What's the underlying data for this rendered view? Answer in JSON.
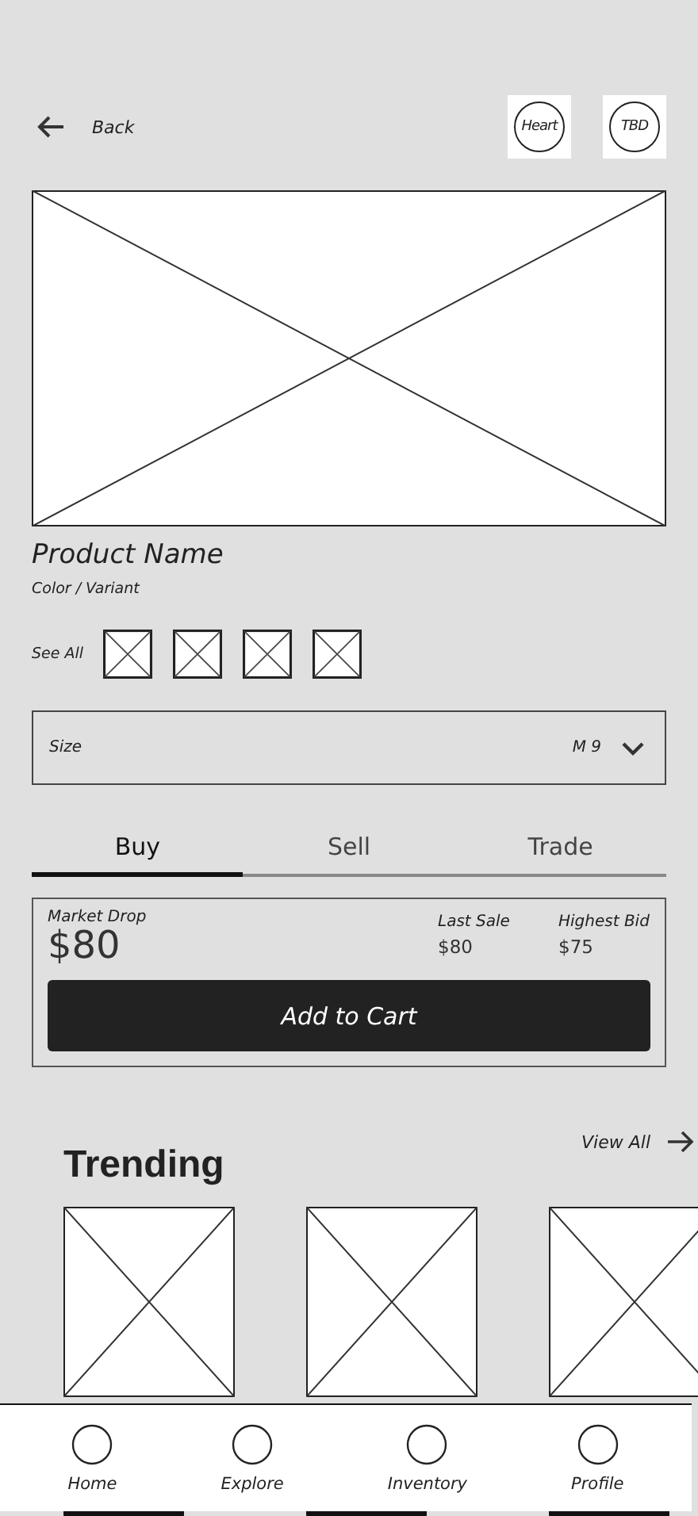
{
  "header": {
    "back_label": "Back",
    "actions": [
      {
        "label": "Heart"
      },
      {
        "label": "TBD"
      }
    ]
  },
  "product": {
    "name": "Product Name",
    "variant": "Color / Variant",
    "see_all": "See All",
    "swatches": [
      {
        "kind": "placeholder"
      },
      {
        "kind": "placeholder"
      },
      {
        "kind": "placeholder"
      },
      {
        "kind": "placeholder"
      }
    ]
  },
  "size": {
    "label": "Size",
    "value": "M 9"
  },
  "tabs": [
    {
      "label": "Buy",
      "selected": true
    },
    {
      "label": "Sell",
      "selected": false
    },
    {
      "label": "Trade",
      "selected": false
    }
  ],
  "price_box": {
    "market_label": "Market Drop",
    "market_price": "$80",
    "stats": [
      {
        "label": "Last Sale",
        "value": "$80"
      },
      {
        "label": "Highest Bid",
        "value": "$75"
      }
    ],
    "button": "Add to Cart"
  },
  "trending": {
    "title": "Trending",
    "link": "View All",
    "items": [
      {
        "kind": "placeholder"
      },
      {
        "kind": "placeholder"
      },
      {
        "kind": "placeholder"
      }
    ]
  },
  "nav": [
    {
      "label": "Home"
    },
    {
      "label": "Explore"
    },
    {
      "label": "Inventory"
    },
    {
      "label": "Profile"
    }
  ]
}
